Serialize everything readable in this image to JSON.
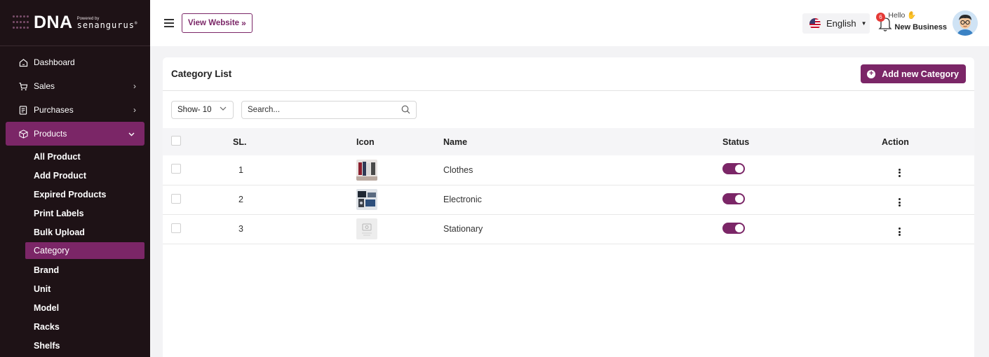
{
  "sidebar": {
    "logo": {
      "main": "DNA",
      "powered_by": "Powered by",
      "brand": "senangurus",
      "mark": "®"
    },
    "items": [
      {
        "label": "Dashboard",
        "icon": "home-icon"
      },
      {
        "label": "Sales",
        "icon": "cart-icon",
        "chevron": "›"
      },
      {
        "label": "Purchases",
        "icon": "receipt-icon",
        "chevron": "›"
      },
      {
        "label": "Products",
        "icon": "box-icon",
        "chevron": "⌄"
      }
    ],
    "products_sub": [
      "All Product",
      "Add Product",
      "Expired Products",
      "Print Labels",
      "Bulk Upload",
      "Category",
      "Brand",
      "Unit",
      "Model",
      "Racks",
      "Shelfs"
    ]
  },
  "topbar": {
    "view_website": "View Website",
    "view_arrow": "»",
    "language": "English",
    "notification_count": "6",
    "hello": "Hello",
    "user_name": "New Business"
  },
  "card": {
    "title": "Category List",
    "add_button": "Add new Category",
    "show_label": "Show- 10",
    "search_placeholder": "Search..."
  },
  "table": {
    "headers": {
      "sl": "SL.",
      "icon": "Icon",
      "name": "Name",
      "status": "Status",
      "action": "Action"
    },
    "rows": [
      {
        "sl": "1",
        "name": "Clothes",
        "status": true
      },
      {
        "sl": "2",
        "name": "Electronic",
        "status": true
      },
      {
        "sl": "3",
        "name": "Stationary",
        "status": true
      }
    ]
  },
  "colors": {
    "accent": "#7b2667",
    "sidebar_bg": "#1e1216",
    "badge": "#e53935"
  }
}
